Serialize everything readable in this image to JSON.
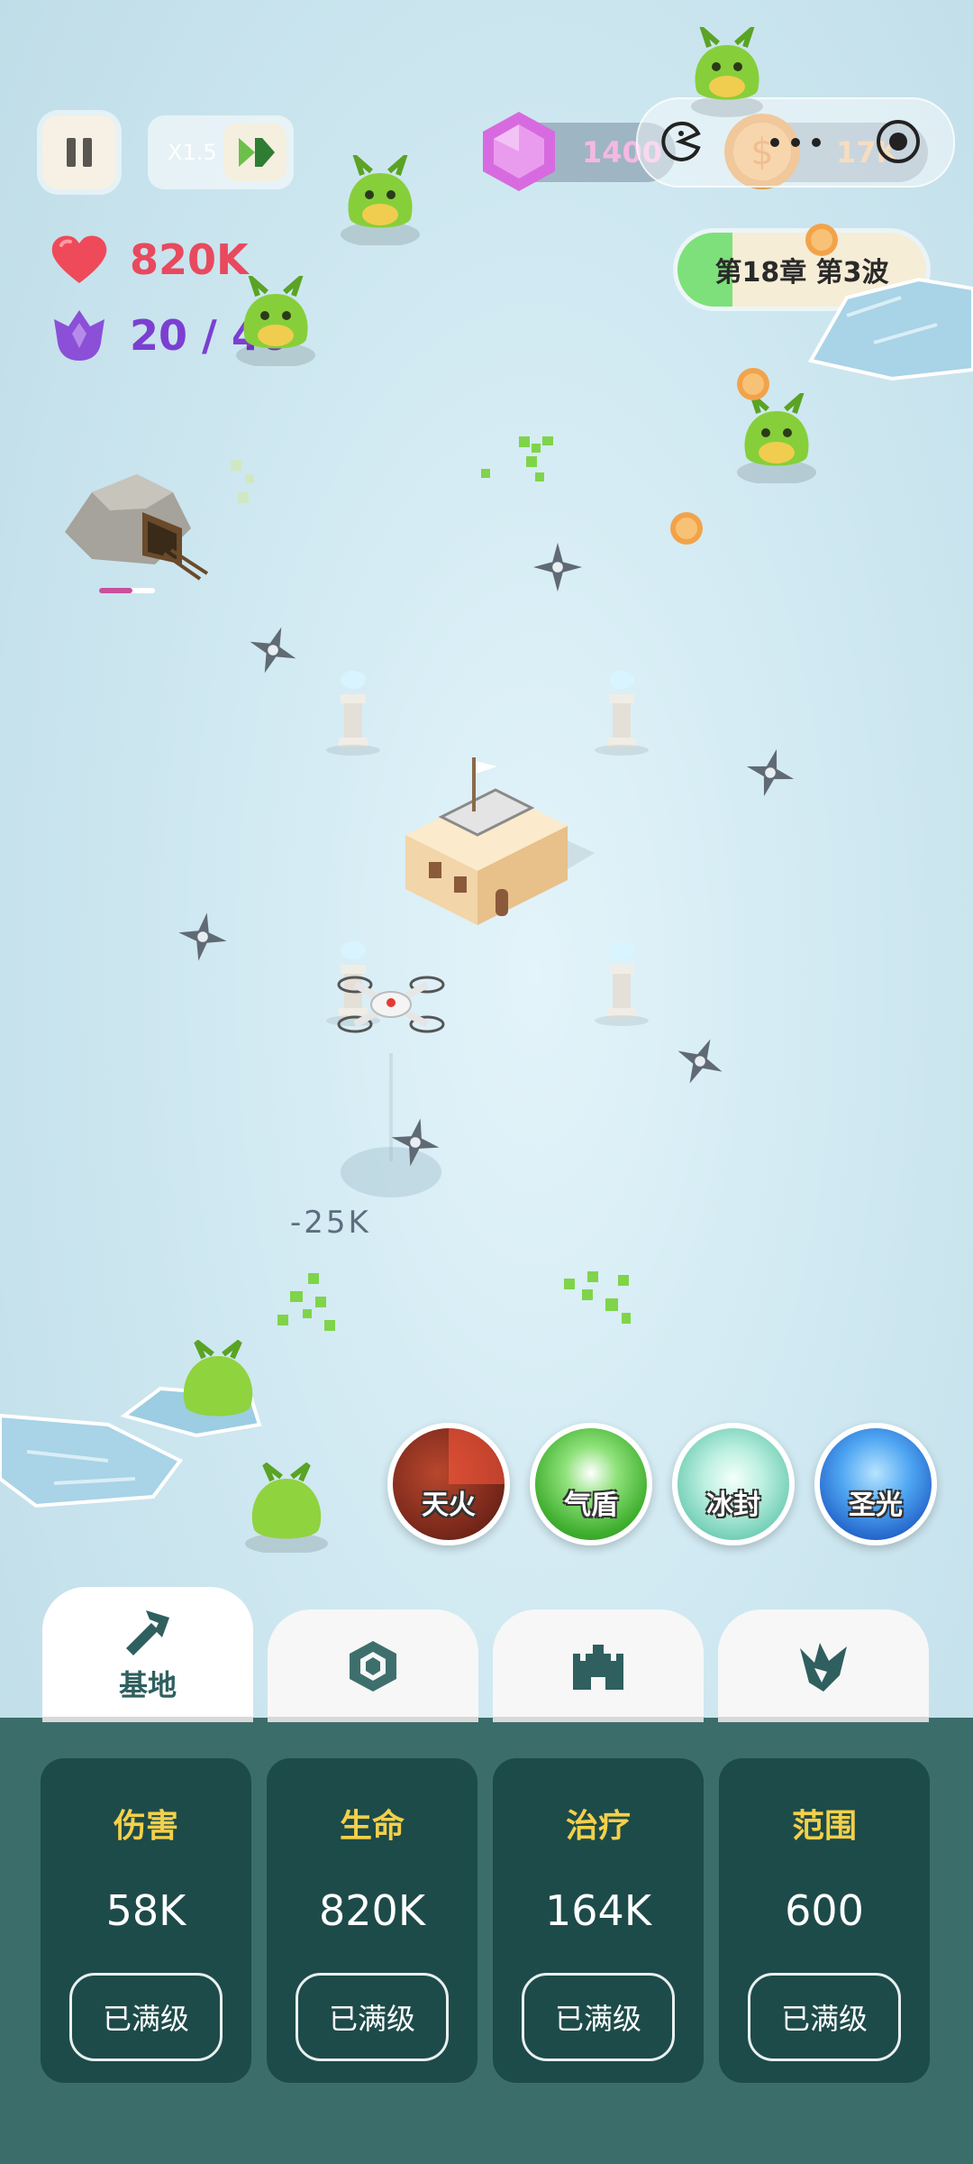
{
  "hud": {
    "speed_label": "X1.5",
    "gems": "1400",
    "coins": "17K",
    "hp": "820K",
    "energy": "20 / 40",
    "chapter_label": "第18章 第3波",
    "chapter_progress": 0.22
  },
  "battle": {
    "damage_text": "-25K"
  },
  "skills": [
    {
      "label": "天火",
      "color": "#8b2d1f"
    },
    {
      "label": "气盾",
      "color": "#3fae2e"
    },
    {
      "label": "冰封",
      "color": "#7fd9c3"
    },
    {
      "label": "圣光",
      "color": "#2b6fd6"
    }
  ],
  "tabs": [
    {
      "label": "基地",
      "icon": "hammer-icon",
      "active": true
    },
    {
      "label": "",
      "icon": "gem-icon",
      "active": false
    },
    {
      "label": "",
      "icon": "castle-icon",
      "active": false
    },
    {
      "label": "",
      "icon": "crystal-icon",
      "active": false
    }
  ],
  "cards": [
    {
      "title": "伤害",
      "value": "58K",
      "button": "已满级"
    },
    {
      "title": "生命",
      "value": "820K",
      "button": "已满级"
    },
    {
      "title": "治疗",
      "value": "164K",
      "button": "已满级"
    },
    {
      "title": "范围",
      "value": "600",
      "button": "已满级"
    }
  ],
  "colors": {
    "panel": "#3b6d6b",
    "card": "#1d4b49",
    "card_title": "#f4d04a",
    "hp_text": "#e8495e",
    "energy_text": "#7b3fd1"
  }
}
